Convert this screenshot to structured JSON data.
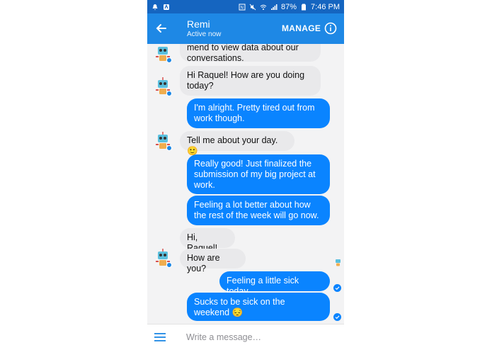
{
  "status_bar": {
    "battery": "87%",
    "time": "7:46 PM",
    "icons": [
      "notification-icon",
      "app-icon",
      "nfc-icon",
      "mute-icon",
      "wifi-icon",
      "signal-icon",
      "battery-icon"
    ]
  },
  "header": {
    "contact_name": "Remi",
    "status": "Active now",
    "manage_label": "MANAGE",
    "colors": {
      "statusbar": "#1565c0",
      "appbar": "#1e88e5"
    }
  },
  "messages": [
    {
      "sender": "bot",
      "text": "mend to view data about our conversations."
    },
    {
      "sender": "bot",
      "text": "Hi Raquel! How are you doing today?"
    },
    {
      "sender": "user",
      "text": "I'm alright. Pretty tired out from work though."
    },
    {
      "sender": "bot",
      "text": "Tell me about your day. 🙂"
    },
    {
      "sender": "user",
      "text": "Really good! Just finalized the submission of my big project at work."
    },
    {
      "sender": "user",
      "text": "Feeling a lot better about how the rest of the week will go now."
    },
    {
      "sender": "bot",
      "text": "Hi, Raquel!"
    },
    {
      "sender": "bot",
      "text": "How are you?"
    },
    {
      "sender": "user",
      "text": "Feeling a little sick today."
    },
    {
      "sender": "user",
      "text": "Sucks to be sick on the weekend 😔"
    }
  ],
  "composer": {
    "placeholder": "Write a message…"
  },
  "colors": {
    "outgoing_bubble": "#0a84ff",
    "incoming_bubble": "#e9e9eb",
    "background": "#f3f3f4"
  }
}
